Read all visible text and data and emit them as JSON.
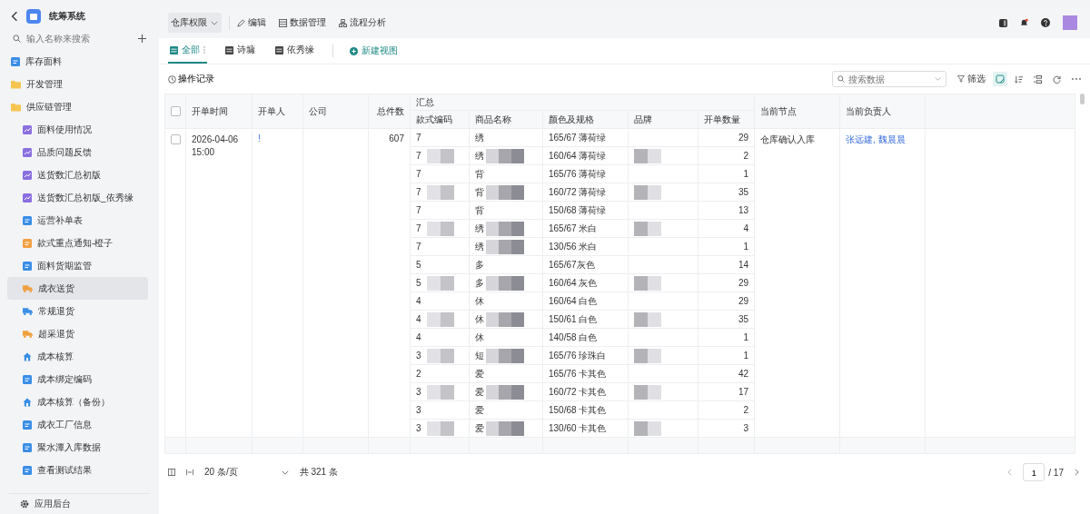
{
  "app": {
    "title": "统筹系统",
    "search": {
      "placeholder": "输入名称来搜索"
    },
    "nav": [
      {
        "label": "库存面料",
        "kind": "doc",
        "color": "#3a8ee6",
        "selected": false
      },
      {
        "label": "开发管理",
        "kind": "folder",
        "color": "#f5c451",
        "selected": false
      },
      {
        "label": "供应链管理",
        "kind": "folder",
        "color": "#f5c451",
        "selected": false,
        "children": [
          {
            "label": "面料使用情况",
            "kind": "chart",
            "color": "#8b6fe0",
            "selected": false
          },
          {
            "label": "品质问题反馈",
            "kind": "chart",
            "color": "#8b6fe0",
            "selected": false
          },
          {
            "label": "送货数汇总初版",
            "kind": "chart",
            "color": "#8b6fe0",
            "selected": false
          },
          {
            "label": "送货数汇总初版_依秀缘",
            "kind": "chart",
            "color": "#8b6fe0",
            "selected": false
          },
          {
            "label": "运营补单表",
            "kind": "doc",
            "color": "#3a8ee6",
            "selected": false
          },
          {
            "label": "款式重点通知-橙子",
            "kind": "doc",
            "color": "#f0a040",
            "selected": false
          },
          {
            "label": "面料货期监管",
            "kind": "doc",
            "color": "#3a8ee6",
            "selected": false
          },
          {
            "label": "成衣送货",
            "kind": "truck",
            "color": "#f0a040",
            "selected": true
          },
          {
            "label": "常规退货",
            "kind": "truck",
            "color": "#3a8ee6",
            "selected": false
          },
          {
            "label": "超采退货",
            "kind": "truck",
            "color": "#f0a040",
            "selected": false
          },
          {
            "label": "成本核算",
            "kind": "home",
            "color": "#3a8ee6",
            "selected": false
          },
          {
            "label": "成本绑定编码",
            "kind": "doc",
            "color": "#3a8ee6",
            "selected": false
          },
          {
            "label": "成本核算（备份）",
            "kind": "home",
            "color": "#3a8ee6",
            "selected": false
          },
          {
            "label": "成衣工厂信息",
            "kind": "doc",
            "color": "#3a8ee6",
            "selected": false
          },
          {
            "label": "聚水潭入库数据",
            "kind": "doc",
            "color": "#3a8ee6",
            "selected": false
          },
          {
            "label": "查看测试结果",
            "kind": "doc",
            "color": "#3a8ee6",
            "selected": false
          }
        ]
      }
    ],
    "footer": "应用后台"
  },
  "topbar": {
    "dropdown": "仓库权限",
    "actions": [
      {
        "label": "编辑",
        "kind": "pencil"
      },
      {
        "label": "数据管理",
        "kind": "table"
      },
      {
        "label": "流程分析",
        "kind": "flow"
      }
    ]
  },
  "views": {
    "tabs": [
      {
        "label": "全部",
        "selected": true
      },
      {
        "label": "诗墉",
        "selected": false
      },
      {
        "label": "依秀缘",
        "selected": false
      }
    ],
    "new_view": "新建视图"
  },
  "toolbar": {
    "history": "操作记录",
    "search": {
      "placeholder": "搜索数据"
    },
    "filter": "筛选"
  },
  "table": {
    "columns": [
      "开单时间",
      "开单人",
      "公司",
      "总件数"
    ],
    "group": "汇总",
    "group_columns": [
      "款式编码",
      "商品名称",
      "颜色及规格",
      "品牌",
      "开单数量"
    ],
    "tail_columns": [
      "当前节点",
      "当前负责人"
    ],
    "select_all_checked": false,
    "record": {
      "checked": false,
      "time": "2026-04-06 15:00",
      "creator": "!",
      "total": "607",
      "node": "仓库确认入库",
      "owner": "张远建, 魏晨晨"
    },
    "rows": [
      {
        "code": "7",
        "code_blurred": false,
        "name": "绣",
        "name_blurred": false,
        "spec": "165/67 薄荷绿",
        "brand_blurred": false,
        "qty": "29"
      },
      {
        "code": "7",
        "code_blurred": true,
        "name": "绣",
        "name_blurred": true,
        "spec": "160/64 薄荷绿",
        "brand_blurred": true,
        "qty": "2"
      },
      {
        "code": "7",
        "code_blurred": false,
        "name": "背",
        "name_blurred": false,
        "spec": "165/76 薄荷绿",
        "brand_blurred": false,
        "qty": "1"
      },
      {
        "code": "7",
        "code_blurred": true,
        "name": "背",
        "name_blurred": true,
        "spec": "160/72 薄荷绿",
        "brand_blurred": true,
        "qty": "35"
      },
      {
        "code": "7",
        "code_blurred": false,
        "name": "背",
        "name_blurred": false,
        "spec": "150/68 薄荷绿",
        "brand_blurred": false,
        "qty": "13"
      },
      {
        "code": "7",
        "code_blurred": true,
        "name": "绣",
        "name_blurred": true,
        "spec": "165/67 米白",
        "brand_blurred": true,
        "qty": "4"
      },
      {
        "code": "7",
        "code_blurred": false,
        "name": "绣",
        "name_blurred": true,
        "spec": "130/56 米白",
        "brand_blurred": false,
        "qty": "1"
      },
      {
        "code": "5",
        "code_blurred": false,
        "name": "多",
        "name_blurred": false,
        "spec": "165/67灰色",
        "brand_blurred": false,
        "qty": "14"
      },
      {
        "code": "5",
        "code_blurred": true,
        "name": "多",
        "name_blurred": true,
        "spec": "160/64 灰色",
        "brand_blurred": true,
        "qty": "29"
      },
      {
        "code": "4",
        "code_blurred": false,
        "name": "休",
        "name_blurred": false,
        "spec": "160/64 白色",
        "brand_blurred": false,
        "qty": "29"
      },
      {
        "code": "4",
        "code_blurred": true,
        "name": "休",
        "name_blurred": true,
        "spec": "150/61 白色",
        "brand_blurred": true,
        "qty": "35"
      },
      {
        "code": "4",
        "code_blurred": false,
        "name": "休",
        "name_blurred": false,
        "spec": "140/58 白色",
        "brand_blurred": false,
        "qty": "1"
      },
      {
        "code": "3",
        "code_blurred": true,
        "name": "短",
        "name_blurred": true,
        "spec": "165/76 珍珠白",
        "brand_blurred": true,
        "qty": "1"
      },
      {
        "code": "2",
        "code_blurred": false,
        "name": "爱",
        "name_blurred": false,
        "spec": "165/76 卡其色",
        "brand_blurred": false,
        "qty": "42"
      },
      {
        "code": "3",
        "code_blurred": true,
        "name": "爱",
        "name_blurred": true,
        "spec": "160/72 卡其色",
        "brand_blurred": true,
        "qty": "17"
      },
      {
        "code": "3",
        "code_blurred": false,
        "name": "爱",
        "name_blurred": false,
        "spec": "150/68 卡其色",
        "brand_blurred": false,
        "qty": "2"
      },
      {
        "code": "3",
        "code_blurred": true,
        "name": "爱",
        "name_blurred": true,
        "spec": "130/60 卡其色",
        "brand_blurred": true,
        "qty": "3"
      }
    ]
  },
  "pagination": {
    "page_size": "20 条/页",
    "total": "共 321 条",
    "page": "1",
    "pages": "/ 17"
  }
}
